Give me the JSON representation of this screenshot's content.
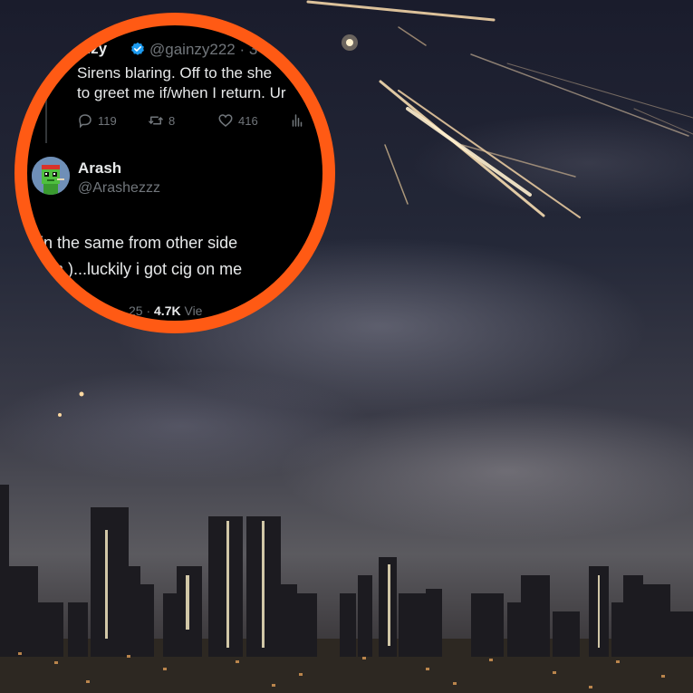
{
  "colors": {
    "ring": "#ff5a14",
    "tweet_bg": "#000000",
    "text_primary": "#e7e9ea",
    "text_secondary": "#71767b",
    "verified_badge": "#1d9bf0"
  },
  "tweet_parent": {
    "name_fragment": "inzy",
    "handle_fragment": "@gainzy222 · 3",
    "text_lines": [
      "Sirens blaring. Off to the she",
      "to greet me if/when I return. Ur"
    ],
    "reply_count": "119",
    "retweet_count": "8",
    "like_count": "416",
    "icons": [
      "reply-icon",
      "retweet-icon",
      "like-icon",
      "analytics-icon",
      "verified-badge-icon"
    ]
  },
  "tweet_reply": {
    "name": "Arash",
    "handle": "@Arashezzz",
    "text_lines": [
      "in the same from other side",
      "ran )...luckily i got cig on me"
    ],
    "date_fragment": "25 · ",
    "views_count": "4.7K",
    "views_label": " Vie",
    "avatar_icon": "pixel-avatar-icon"
  }
}
